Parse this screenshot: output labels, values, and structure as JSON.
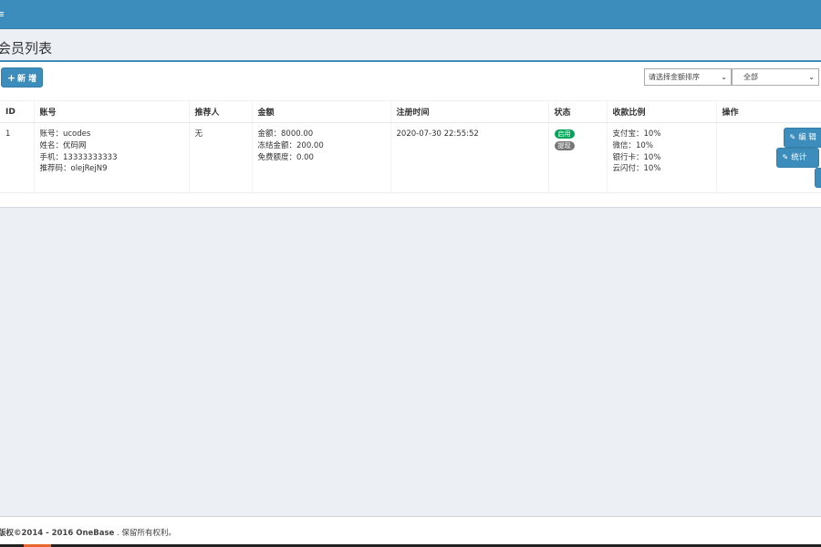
{
  "topbar": {
    "nav_icon": "≡"
  },
  "page": {
    "title": "会员列表"
  },
  "toolbar": {
    "add_label": "新 增",
    "sort_select": "请选择金额排序",
    "status_select": "全部"
  },
  "table": {
    "headers": [
      "ID",
      "账号",
      "推荐人",
      "金额",
      "注册时间",
      "状态",
      "收款比例",
      "操作"
    ],
    "rows": [
      {
        "id": "1",
        "account": [
          "账号：ucodes",
          "姓名：优码网",
          "手机：13333333333",
          "推荐码：olejRejN9"
        ],
        "referrer": "无",
        "amount": [
          "金额：8000.00",
          "冻结金额：200.00",
          "免费额度：0.00"
        ],
        "reg_time": "2020-07-30 22:55:52",
        "status_on": "启用",
        "status_off": "提现",
        "ratio": [
          "支付宝：10%",
          "微信：10%",
          "银行卡：10%",
          "云闪付：10%"
        ],
        "edit_label": "编 辑",
        "stat_label": "统计"
      }
    ]
  },
  "footer": {
    "copyright": "版权©2014 - 2016 OneBase",
    "rights": ". 保留所有权利。"
  },
  "colors": {
    "primary": "#3c8dbc",
    "success": "#00a65a",
    "muted": "#777777",
    "background": "#ecf0f5"
  }
}
